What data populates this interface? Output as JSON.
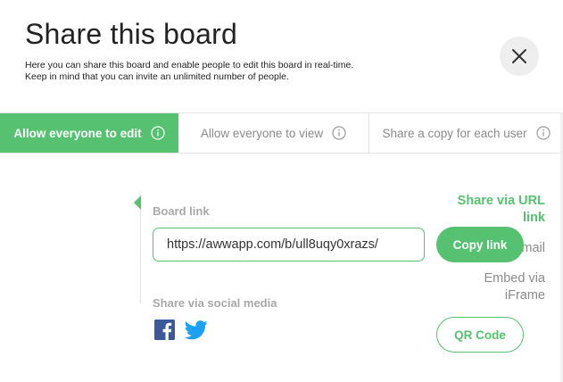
{
  "dialog": {
    "title": "Share this board",
    "description_line1": "Here you can share this board and enable people to edit this board in real-time.",
    "description_line2": "Keep in mind that you can invite an unlimited number of people."
  },
  "tabs": [
    {
      "label": "Allow everyone to edit",
      "active": true
    },
    {
      "label": "Allow everyone to view",
      "active": false
    },
    {
      "label": "Share a copy for each user",
      "active": false
    }
  ],
  "sidenav": {
    "items": [
      {
        "line1": "Share via URL",
        "line2": "link",
        "active": true
      },
      {
        "line1": "Invite via Email",
        "line2": "",
        "active": false
      },
      {
        "line1": "Embed via",
        "line2": "iFrame",
        "active": false
      }
    ]
  },
  "link_section": {
    "label": "Board link",
    "url": "https://awwapp.com/b/ull8uqy0xrazs/",
    "copy_button": "Copy link"
  },
  "social_section": {
    "label": "Share via social media",
    "icons": [
      "facebook-icon",
      "twitter-icon"
    ],
    "qr_button": "QR Code"
  },
  "colors": {
    "accent": "#56c271",
    "muted_text": "#8a8a8a",
    "divider": "#e4e4e4"
  }
}
